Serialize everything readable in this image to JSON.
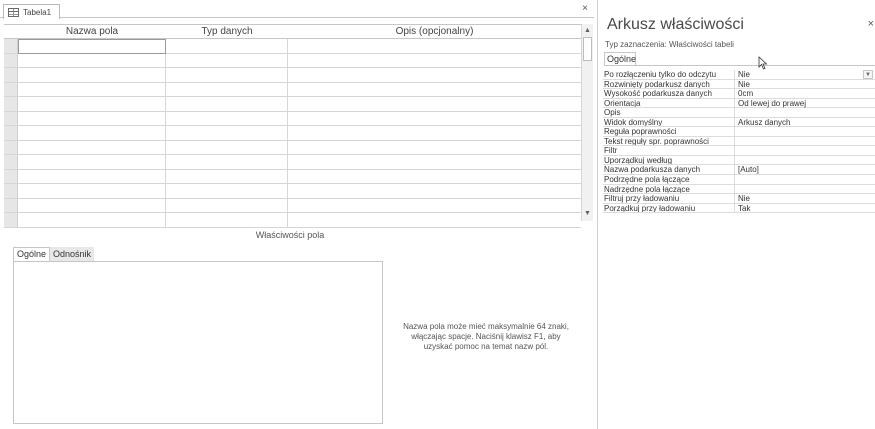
{
  "document_tab": {
    "label": "Tabela1",
    "close_symbol": "×"
  },
  "grid": {
    "headers": [
      "Nazwa pola",
      "Typ danych",
      "Opis (opcjonalny)"
    ],
    "row_count": 13
  },
  "field_properties": {
    "title": "Właściwości pola",
    "tabs": [
      "Ogólne",
      "Odnośnik"
    ],
    "help_text": "Nazwa pola może mieć maksymalnie 64 znaki, włączając spacje. Naciśnij klawisz F1, aby uzyskać pomoc na temat nazw pól."
  },
  "property_sheet": {
    "title": "Arkusz właściwości",
    "close_symbol": "×",
    "selection_type": "Typ zaznaczenia:  Właściwości tabeli",
    "tab": "Ogólne",
    "properties": [
      {
        "name": "Po rozłączeniu tylko do odczytu",
        "value": "Nie"
      },
      {
        "name": "Rozwinięty podarkusz danych",
        "value": "Nie"
      },
      {
        "name": "Wysokość podarkusza danych",
        "value": "0cm"
      },
      {
        "name": "Orientacja",
        "value": "Od lewej do prawej"
      },
      {
        "name": "Opis",
        "value": ""
      },
      {
        "name": "Widok domyślny",
        "value": "Arkusz danych"
      },
      {
        "name": "Reguła poprawności",
        "value": ""
      },
      {
        "name": "Tekst reguły spr. poprawności",
        "value": ""
      },
      {
        "name": "Filtr",
        "value": ""
      },
      {
        "name": "Uporządkuj według",
        "value": ""
      },
      {
        "name": "Nazwa podarkusza danych",
        "value": "[Auto]"
      },
      {
        "name": "Podrzędne pola łączące",
        "value": ""
      },
      {
        "name": "Nadrzędne pola łączące",
        "value": ""
      },
      {
        "name": "Filtruj przy ładowaniu",
        "value": "Nie"
      },
      {
        "name": "Porządkuj przy ładowaniu",
        "value": "Tak"
      }
    ]
  },
  "icons": {
    "table": "table-icon",
    "dropdown": "chevron-down-icon",
    "scroll_up": "scroll-up-arrow-icon",
    "scroll_down": "scroll-down-arrow-icon",
    "cursor": "mouse-pointer-icon"
  }
}
